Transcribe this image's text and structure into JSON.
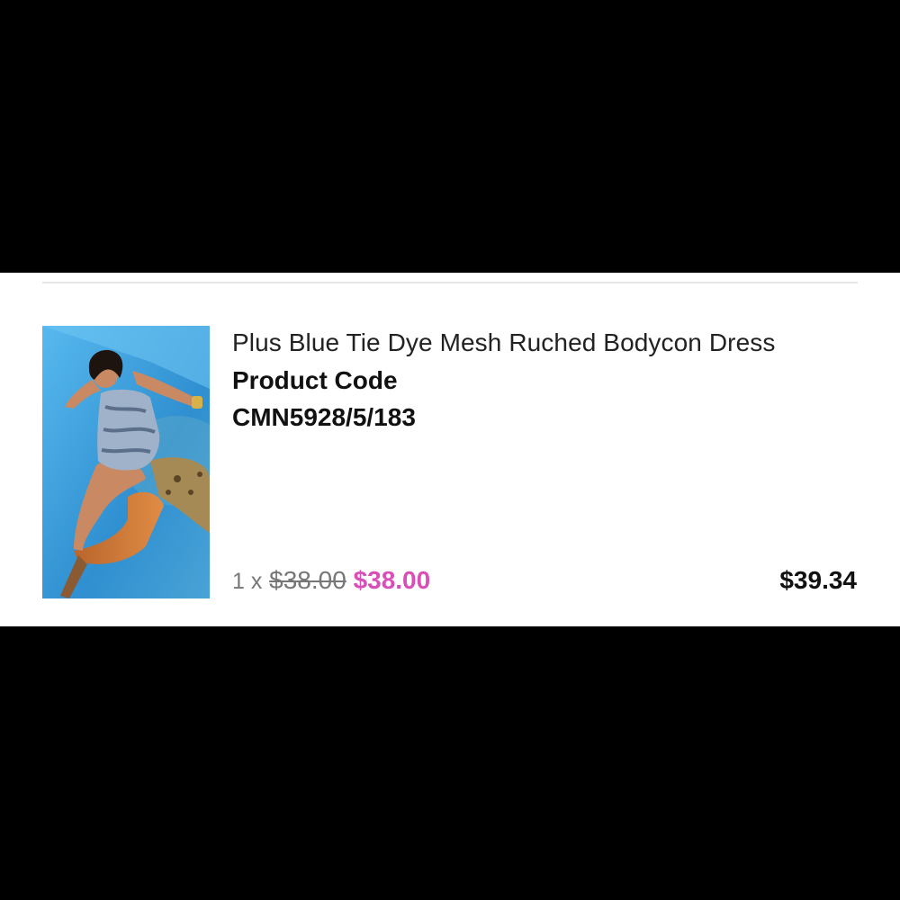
{
  "item": {
    "title": "Plus Blue Tie Dye Mesh Ruched Bodycon Dress",
    "code_label": "Product Code",
    "code_value": "CMN5928/5/183",
    "quantity_text": "1 x",
    "original_price": "$38.00",
    "sale_price": "$38.00",
    "line_total": "$39.34",
    "image_icon": "product-photo"
  },
  "colors": {
    "sale": "#d94fb8",
    "text": "#111111",
    "muted": "#777777",
    "divider": "#e6e6e6",
    "photo_bg": "#3f9fd8"
  }
}
